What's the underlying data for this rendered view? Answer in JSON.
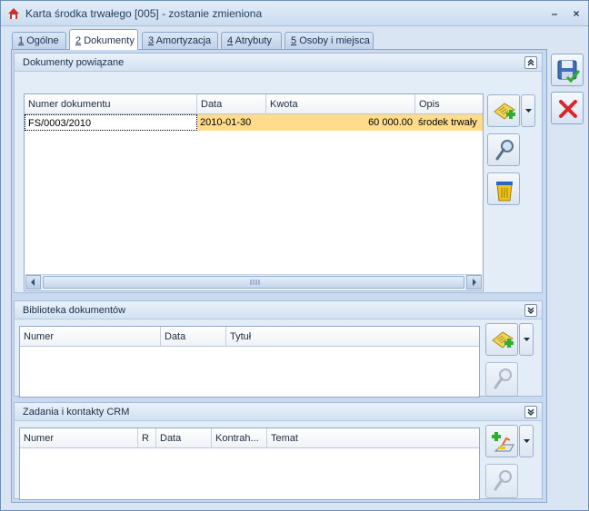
{
  "window": {
    "title": "Karta środka trwałego [005] - zostanie zmieniona",
    "minimize_label": "–",
    "close_label": "×"
  },
  "tabs": [
    {
      "key": "1",
      "label": "Ogólne"
    },
    {
      "key": "2",
      "label": "Dokumenty"
    },
    {
      "key": "3",
      "label": "Amortyzacja"
    },
    {
      "key": "4",
      "label": "Atrybuty"
    },
    {
      "key": "5",
      "label": "Osoby i miejsca"
    }
  ],
  "active_tab": "Dokumenty",
  "dokumenty": {
    "title": "Dokumenty powiązane",
    "columns": [
      "Numer dokumentu",
      "Data",
      "Kwota",
      "Opis"
    ],
    "rows": [
      {
        "numer": "FS/0003/2010",
        "data": "2010-01-30",
        "kwota": "60 000.00",
        "opis": "środek trwały"
      }
    ]
  },
  "biblioteka": {
    "title": "Biblioteka dokumentów",
    "columns": [
      "Numer",
      "Data",
      "Tytuł"
    ]
  },
  "crm": {
    "title": "Zadania i kontakty CRM",
    "columns": [
      "Numer",
      "R",
      "Data",
      "Kontrah...",
      "Temat"
    ]
  },
  "icons": {
    "save": "save-icon",
    "cancel": "cancel-icon",
    "add": "add-document-icon",
    "view": "magnifier-icon",
    "delete": "trash-icon"
  },
  "colors": {
    "selected_row": "#fedc8c",
    "window_bg": "#d9e5f3",
    "accent": "#1f6fce"
  }
}
